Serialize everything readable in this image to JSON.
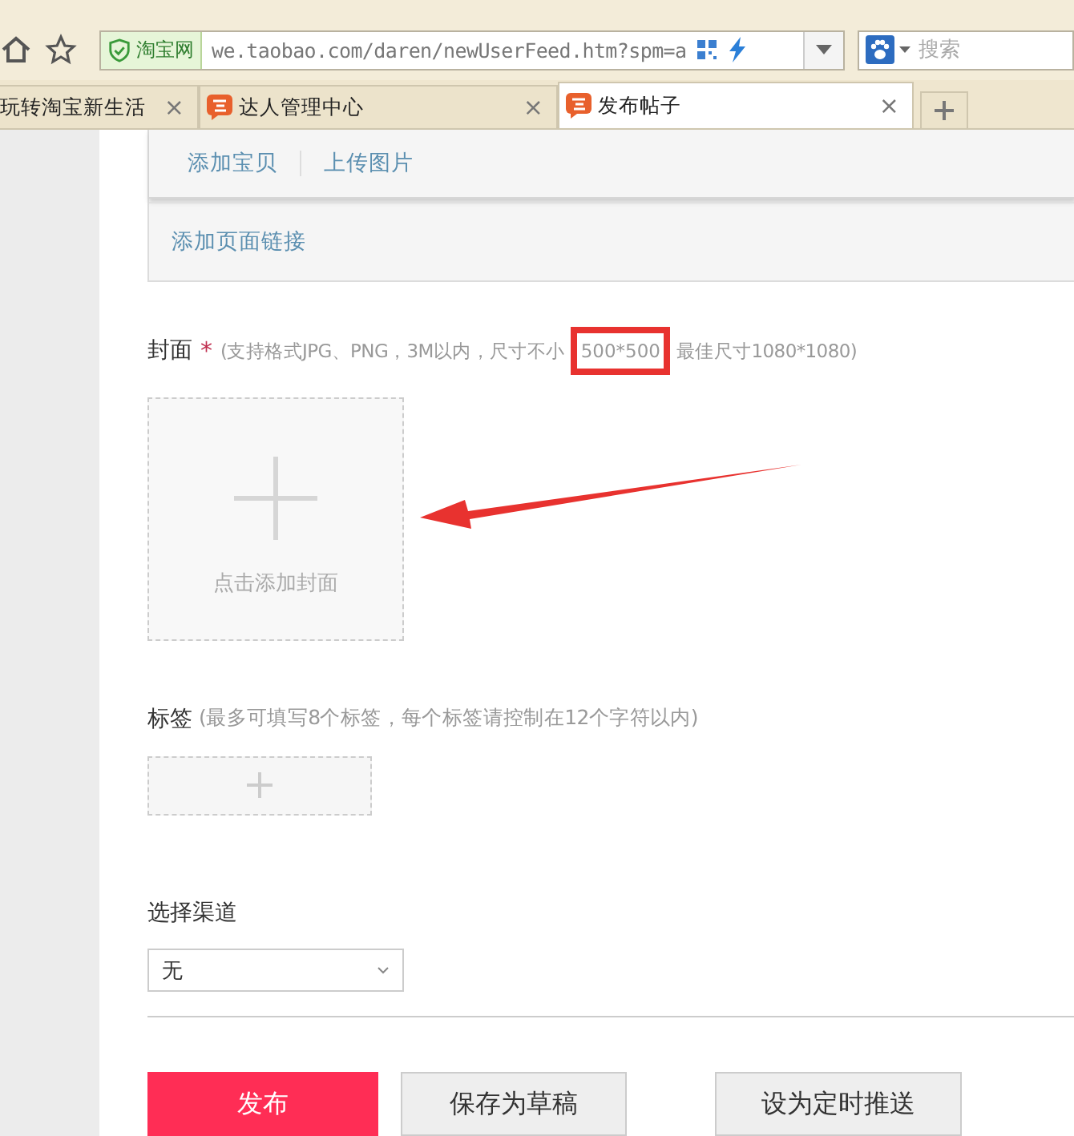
{
  "toolbar": {
    "site_label": "淘宝网",
    "url": "we.taobao.com/daren/newUserFeed.htm?spm=a",
    "search_placeholder": "搜索"
  },
  "tabs": [
    {
      "label": "玩转淘宝新生活",
      "selected": false,
      "icon": false,
      "close": "×"
    },
    {
      "label": "达人管理中心",
      "selected": false,
      "icon": true,
      "close": "×"
    },
    {
      "label": "发布帖子",
      "selected": true,
      "icon": true,
      "close": "×"
    }
  ],
  "editor": {
    "toolbar": [
      "添加宝贝",
      "上传图片"
    ],
    "link": "添加页面链接"
  },
  "cover": {
    "label": "封面",
    "required": "*",
    "hint_before": "(支持格式JPG、PNG，3M以内，尺寸不小",
    "hint_highlight": "500*500",
    "hint_after": "最佳尺寸1080*1080)",
    "upload_text": "点击添加封面"
  },
  "tags": {
    "label": "标签",
    "hint": "(最多可填写8个标签，每个标签请控制在12个字符以内)"
  },
  "channel": {
    "label": "选择渠道",
    "value": "无"
  },
  "buttons": [
    {
      "label": "发布",
      "kind": "primary"
    },
    {
      "label": "保存为草稿",
      "kind": "secondary"
    },
    {
      "label": "设为定时推送",
      "kind": "secondary"
    }
  ]
}
